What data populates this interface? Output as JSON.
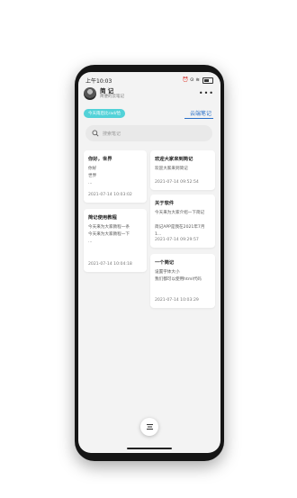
{
  "status": {
    "time": "上午10:03",
    "right": "⏰ ⊙ ≋"
  },
  "profile": {
    "name": "简 记",
    "subtitle": "简便的云笔记"
  },
  "menu_icon": "more-dots-icon",
  "pill_label": "今天雨后比rad/恰",
  "tab_label": "云端笔记",
  "search": {
    "placeholder": "搜索笔记"
  },
  "notes_left": [
    {
      "title": "你好，世界",
      "body": "你好\n世界\n...",
      "date": "2021-07-14 10:03:02"
    },
    {
      "title": "简记使用教程",
      "body": "今天来为大家教程一条\n今天来为大家教程一下\n...",
      "date": "2021-07-14 10:04:18"
    }
  ],
  "notes_right": [
    {
      "title": "欢迎大家来到简记",
      "body": "欢迎大家来到简记",
      "date": "2021-07-14 09:52:54"
    },
    {
      "title": "关于软件",
      "body": "今天来为大家介绍一下简记\n\n简记APP是我在2021年7月1...",
      "date": "2021-07-14 09:29:57"
    },
    {
      "title": "一个简记",
      "body": "设置字体大小\n我们都可以使用html代码",
      "date": "2021-07-14 10:03:29"
    }
  ]
}
